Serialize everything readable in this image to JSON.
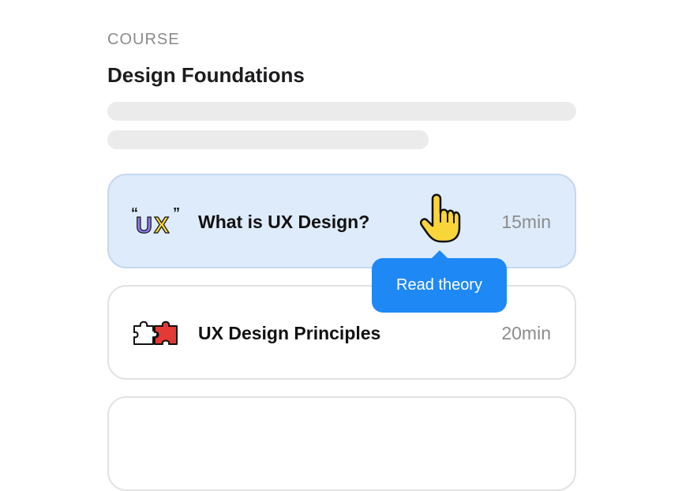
{
  "course": {
    "eyebrow": "COURSE",
    "title": "Design Foundations"
  },
  "lessons": [
    {
      "title": "What is UX Design?",
      "duration": "15min",
      "icon": "ux-quote-icon",
      "state": "hovered"
    },
    {
      "title": "UX Design Principles",
      "duration": "20min",
      "icon": "puzzle-icon",
      "state": "default"
    },
    {
      "title": "",
      "duration": "",
      "icon": "",
      "state": "default"
    }
  ],
  "tooltip": {
    "label": "Read theory"
  },
  "icons": {
    "cursor": "pointing-hand-cursor-icon"
  },
  "colors": {
    "active_card_bg": "#deebfb",
    "tooltip_bg": "#1e88f5",
    "ux_u": "#8e7bf0",
    "ux_x": "#f4d23a",
    "puzzle_red": "#e53935",
    "cursor_fill": "#f8d63a"
  }
}
